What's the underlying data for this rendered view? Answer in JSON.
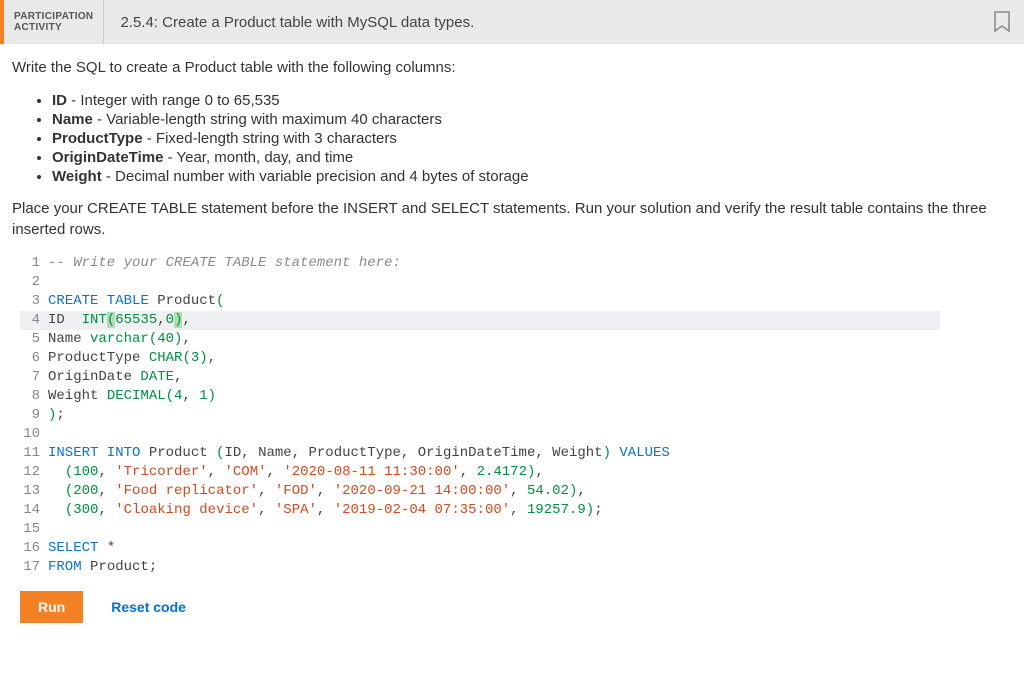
{
  "header": {
    "badge_line1": "PARTICIPATION",
    "badge_line2": "ACTIVITY",
    "title": "2.5.4: Create a Product table with MySQL data types."
  },
  "instructions": {
    "lead": "Write the SQL to create a Product table with the following columns:",
    "columns": [
      {
        "name": "ID",
        "desc": " - Integer with range 0 to 65,535"
      },
      {
        "name": "Name",
        "desc": " - Variable-length string with maximum 40 characters"
      },
      {
        "name": "ProductType",
        "desc": " - Fixed-length string with 3 characters"
      },
      {
        "name": "OriginDateTime",
        "desc": " - Year, month, day, and time"
      },
      {
        "name": "Weight",
        "desc": " - Decimal number with variable precision and 4 bytes of storage"
      }
    ],
    "trail": "Place your CREATE TABLE statement before the INSERT and SELECT statements. Run your solution and verify the result table contains the three inserted rows."
  },
  "code": {
    "highlight_line": 4,
    "lines": [
      {
        "n": 1,
        "tokens": [
          {
            "t": "-- Write your CREATE TABLE statement here:",
            "c": "tok-comment"
          }
        ]
      },
      {
        "n": 2,
        "tokens": []
      },
      {
        "n": 3,
        "tokens": [
          {
            "t": "CREATE TABLE",
            "c": "tok-kw"
          },
          {
            "t": " Product",
            "c": "tok-ident"
          },
          {
            "t": "(",
            "c": "tok-type"
          }
        ]
      },
      {
        "n": 4,
        "tokens": [
          {
            "t": "ID  ",
            "c": "tok-ident"
          },
          {
            "t": "INT",
            "c": "tok-type"
          },
          {
            "t": "(",
            "c": "tok-type tok-paren-hl"
          },
          {
            "t": "65535",
            "c": "tok-num"
          },
          {
            "t": ",",
            "c": "tok-punc"
          },
          {
            "t": "0",
            "c": "tok-num"
          },
          {
            "t": ")",
            "c": "tok-type tok-paren-hl"
          },
          {
            "t": ",",
            "c": "tok-punc"
          }
        ]
      },
      {
        "n": 5,
        "tokens": [
          {
            "t": "Name ",
            "c": "tok-ident"
          },
          {
            "t": "varchar",
            "c": "tok-type"
          },
          {
            "t": "(",
            "c": "tok-type"
          },
          {
            "t": "40",
            "c": "tok-num"
          },
          {
            "t": ")",
            "c": "tok-type"
          },
          {
            "t": ",",
            "c": "tok-punc"
          }
        ]
      },
      {
        "n": 6,
        "tokens": [
          {
            "t": "ProductType ",
            "c": "tok-ident"
          },
          {
            "t": "CHAR",
            "c": "tok-type"
          },
          {
            "t": "(",
            "c": "tok-type"
          },
          {
            "t": "3",
            "c": "tok-num"
          },
          {
            "t": ")",
            "c": "tok-type"
          },
          {
            "t": ",",
            "c": "tok-punc"
          }
        ]
      },
      {
        "n": 7,
        "tokens": [
          {
            "t": "OriginDate ",
            "c": "tok-ident"
          },
          {
            "t": "DATE",
            "c": "tok-type"
          },
          {
            "t": ",",
            "c": "tok-punc"
          }
        ]
      },
      {
        "n": 8,
        "tokens": [
          {
            "t": "Weight ",
            "c": "tok-ident"
          },
          {
            "t": "DECIMAL",
            "c": "tok-type"
          },
          {
            "t": "(",
            "c": "tok-type"
          },
          {
            "t": "4",
            "c": "tok-num"
          },
          {
            "t": ", ",
            "c": "tok-punc"
          },
          {
            "t": "1",
            "c": "tok-num"
          },
          {
            "t": ")",
            "c": "tok-type"
          }
        ]
      },
      {
        "n": 9,
        "tokens": [
          {
            "t": ")",
            "c": "tok-type"
          },
          {
            "t": ";",
            "c": "tok-punc"
          }
        ]
      },
      {
        "n": 10,
        "tokens": []
      },
      {
        "n": 11,
        "tokens": [
          {
            "t": "INSERT INTO",
            "c": "tok-kw"
          },
          {
            "t": " Product ",
            "c": "tok-ident"
          },
          {
            "t": "(",
            "c": "tok-type"
          },
          {
            "t": "ID",
            "c": "tok-ident"
          },
          {
            "t": ", ",
            "c": "tok-punc"
          },
          {
            "t": "Name",
            "c": "tok-ident"
          },
          {
            "t": ", ",
            "c": "tok-punc"
          },
          {
            "t": "ProductType",
            "c": "tok-ident"
          },
          {
            "t": ", ",
            "c": "tok-punc"
          },
          {
            "t": "OriginDateTime",
            "c": "tok-ident"
          },
          {
            "t": ", ",
            "c": "tok-punc"
          },
          {
            "t": "Weight",
            "c": "tok-ident"
          },
          {
            "t": ")",
            "c": "tok-type"
          },
          {
            "t": " VALUES",
            "c": "tok-kw"
          }
        ]
      },
      {
        "n": 12,
        "tokens": [
          {
            "t": "  ",
            "c": ""
          },
          {
            "t": "(",
            "c": "tok-type"
          },
          {
            "t": "100",
            "c": "tok-num"
          },
          {
            "t": ", ",
            "c": "tok-punc"
          },
          {
            "t": "'Tricorder'",
            "c": "tok-str"
          },
          {
            "t": ", ",
            "c": "tok-punc"
          },
          {
            "t": "'COM'",
            "c": "tok-str"
          },
          {
            "t": ", ",
            "c": "tok-punc"
          },
          {
            "t": "'2020-08-11 11:30:00'",
            "c": "tok-str"
          },
          {
            "t": ", ",
            "c": "tok-punc"
          },
          {
            "t": "2.4172",
            "c": "tok-num"
          },
          {
            "t": ")",
            "c": "tok-type"
          },
          {
            "t": ",",
            "c": "tok-punc"
          }
        ]
      },
      {
        "n": 13,
        "tokens": [
          {
            "t": "  ",
            "c": ""
          },
          {
            "t": "(",
            "c": "tok-type"
          },
          {
            "t": "200",
            "c": "tok-num"
          },
          {
            "t": ", ",
            "c": "tok-punc"
          },
          {
            "t": "'Food replicator'",
            "c": "tok-str"
          },
          {
            "t": ", ",
            "c": "tok-punc"
          },
          {
            "t": "'FOD'",
            "c": "tok-str"
          },
          {
            "t": ", ",
            "c": "tok-punc"
          },
          {
            "t": "'2020-09-21 14:00:00'",
            "c": "tok-str"
          },
          {
            "t": ", ",
            "c": "tok-punc"
          },
          {
            "t": "54.02",
            "c": "tok-num"
          },
          {
            "t": ")",
            "c": "tok-type"
          },
          {
            "t": ",",
            "c": "tok-punc"
          }
        ]
      },
      {
        "n": 14,
        "tokens": [
          {
            "t": "  ",
            "c": ""
          },
          {
            "t": "(",
            "c": "tok-type"
          },
          {
            "t": "300",
            "c": "tok-num"
          },
          {
            "t": ", ",
            "c": "tok-punc"
          },
          {
            "t": "'Cloaking device'",
            "c": "tok-str"
          },
          {
            "t": ", ",
            "c": "tok-punc"
          },
          {
            "t": "'SPA'",
            "c": "tok-str"
          },
          {
            "t": ", ",
            "c": "tok-punc"
          },
          {
            "t": "'2019-02-04 07:35:00'",
            "c": "tok-str"
          },
          {
            "t": ", ",
            "c": "tok-punc"
          },
          {
            "t": "19257.9",
            "c": "tok-num"
          },
          {
            "t": ")",
            "c": "tok-type"
          },
          {
            "t": ";",
            "c": "tok-punc"
          }
        ]
      },
      {
        "n": 15,
        "tokens": []
      },
      {
        "n": 16,
        "tokens": [
          {
            "t": "SELECT",
            "c": "tok-kw"
          },
          {
            "t": " *",
            "c": "tok-punc"
          }
        ]
      },
      {
        "n": 17,
        "tokens": [
          {
            "t": "FROM",
            "c": "tok-kw"
          },
          {
            "t": " Product",
            "c": "tok-ident"
          },
          {
            "t": ";",
            "c": "tok-punc"
          }
        ]
      }
    ]
  },
  "buttons": {
    "run": "Run",
    "reset": "Reset code"
  }
}
